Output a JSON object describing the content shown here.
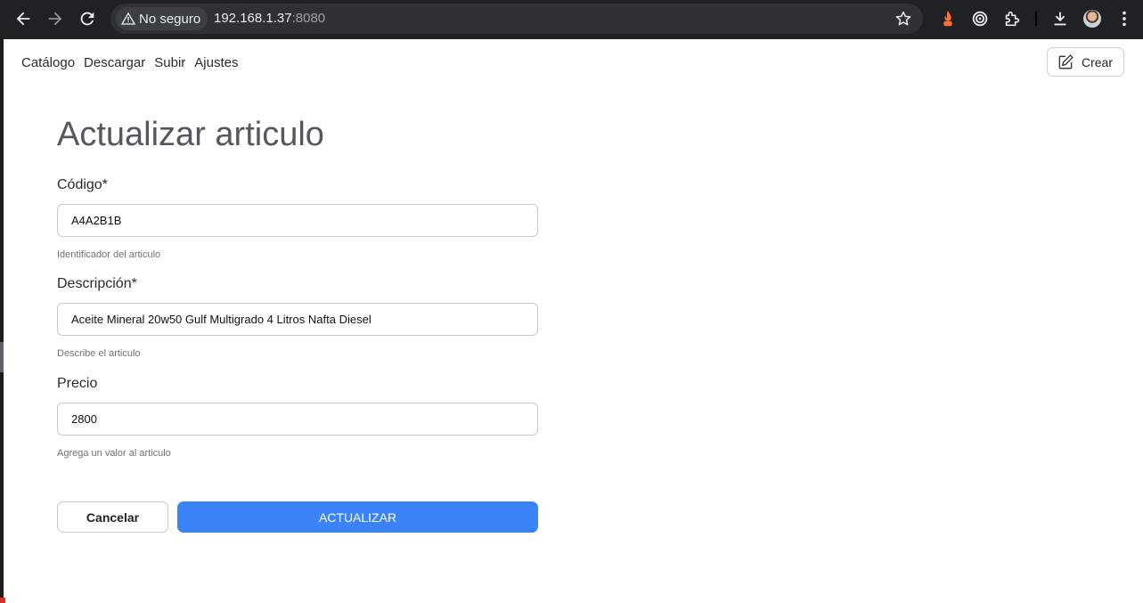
{
  "browser": {
    "security_label": "No seguro",
    "url_host": "192.168.1.37",
    "url_port": ":8080",
    "icons": [
      "back-icon",
      "forward-icon",
      "reload-icon",
      "warning-icon",
      "bookmark-star-icon",
      "extension-flame-icon",
      "extension-target-icon",
      "extensions-puzzle-icon",
      "download-icon",
      "profile-avatar-icon",
      "menu-kebab-icon"
    ]
  },
  "nav": {
    "items": [
      {
        "label": "Catálogo"
      },
      {
        "label": "Descargar"
      },
      {
        "label": "Subir"
      },
      {
        "label": "Ajustes"
      }
    ],
    "create_label": "Crear"
  },
  "form": {
    "title": "Actualizar articulo",
    "code": {
      "label": "Código*",
      "value": "A4A2B1B",
      "help": "Identificador del articulo"
    },
    "description": {
      "label": "Descripción*",
      "value": "Aceite Mineral 20w50 Gulf Multigrado 4 Litros Nafta Diesel",
      "help": "Describe el articulo"
    },
    "price": {
      "label": "Precio",
      "value": "2800",
      "help": "Agrega un valor al articulo"
    },
    "cancel_label": "Cancelar",
    "submit_label": "ACTUALIZAR"
  },
  "colors": {
    "chrome_bg": "#202124",
    "primary": "#3b82f6",
    "title": "#55575f"
  }
}
